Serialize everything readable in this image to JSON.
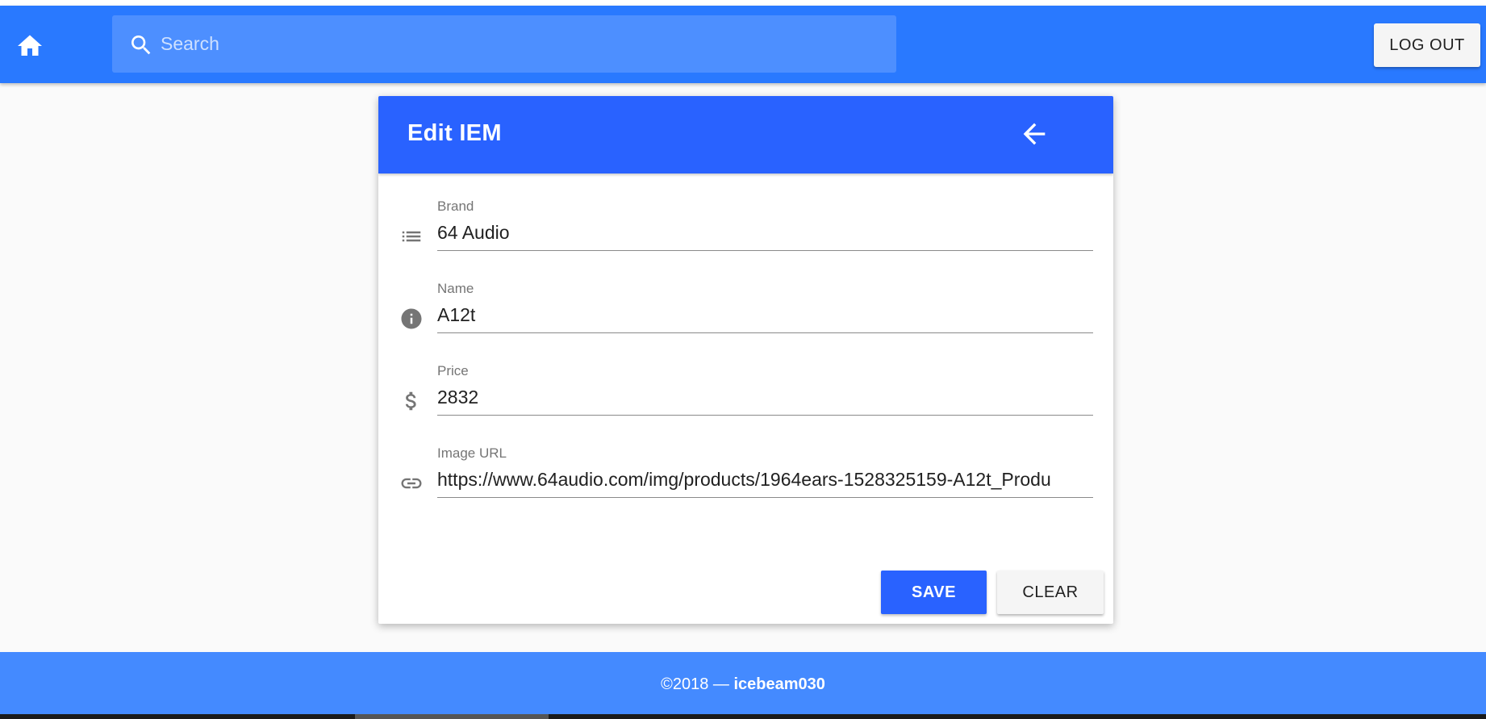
{
  "appbar": {
    "search_placeholder": "Search",
    "logout_label": "LOG OUT",
    "icons": {
      "home": "home-icon",
      "search": "search-icon"
    },
    "color": "#2979ff"
  },
  "card": {
    "title": "Edit IEM",
    "header_color": "#2962ff",
    "back_icon": "arrow-back-icon",
    "fields": [
      {
        "label": "Brand",
        "value": "64 Audio",
        "icon": "list-icon"
      },
      {
        "label": "Name",
        "value": "A12t",
        "icon": "info-icon"
      },
      {
        "label": "Price",
        "value": "2832",
        "icon": "dollar-icon"
      },
      {
        "label": "Image URL",
        "value": "https://www.64audio.com/img/products/1964ears-1528325159-A12t_Produ",
        "icon": "link-icon"
      }
    ],
    "save_label": "SAVE",
    "clear_label": "CLEAR"
  },
  "footer": {
    "copyright": "©2018 — ",
    "author": "icebeam030",
    "color": "#448aff"
  }
}
